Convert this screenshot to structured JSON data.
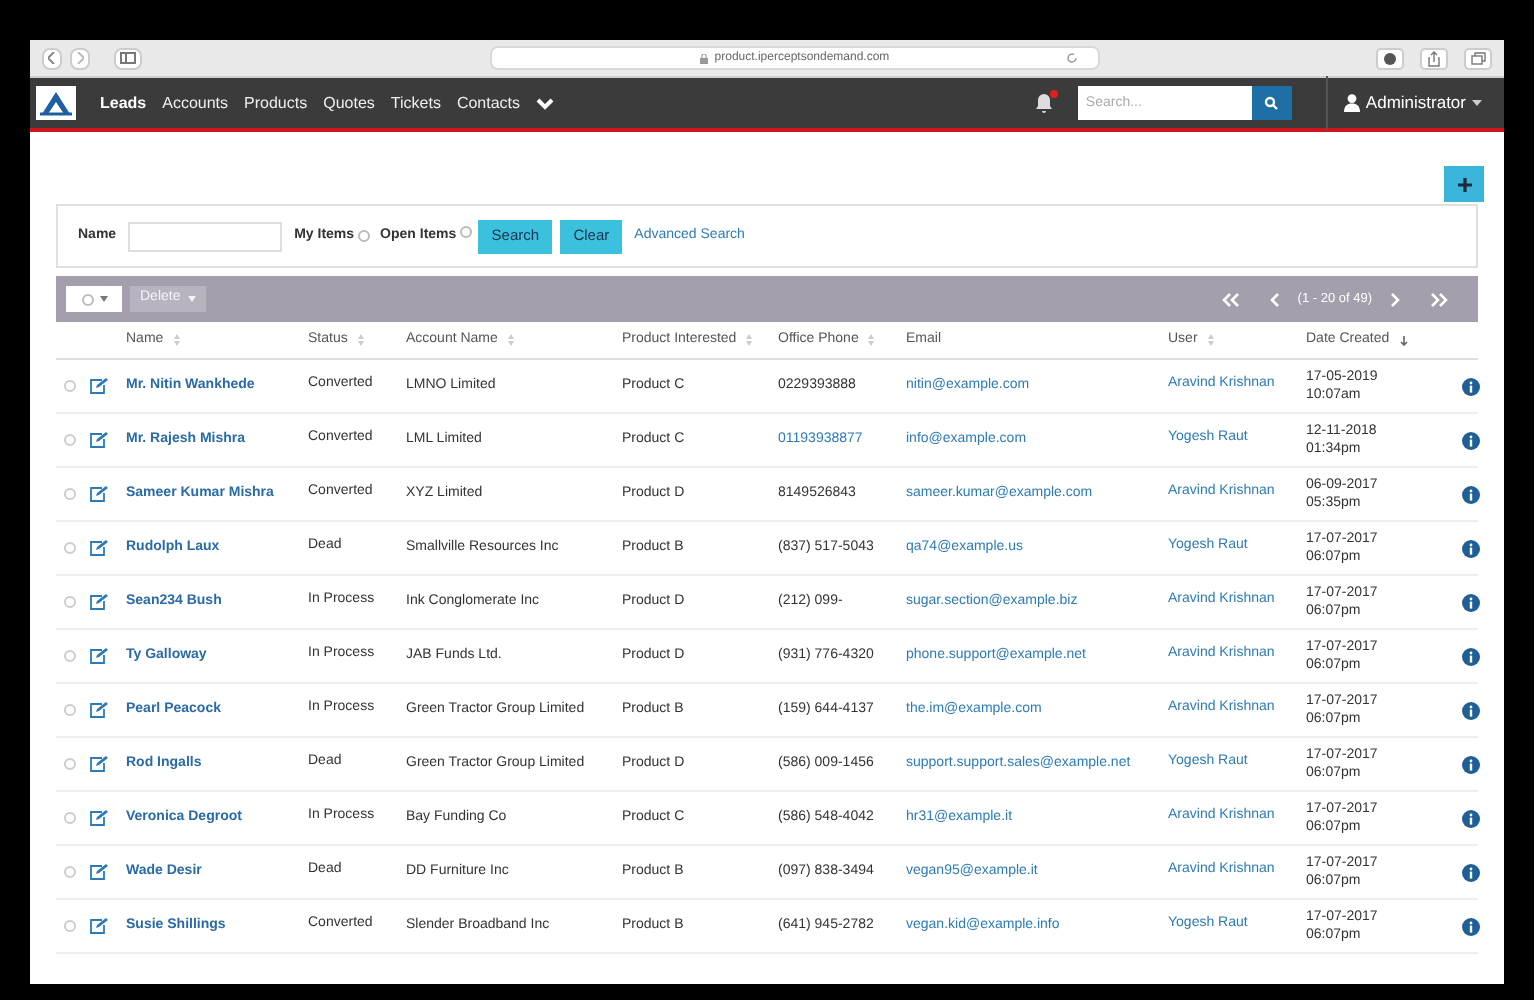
{
  "browser": {
    "url": "product.iperceptsondemand.com"
  },
  "nav": {
    "items": [
      {
        "label": "Leads",
        "selected": true
      },
      {
        "label": "Accounts",
        "selected": false
      },
      {
        "label": "Products",
        "selected": false
      },
      {
        "label": "Quotes",
        "selected": false
      },
      {
        "label": "Tickets",
        "selected": false
      },
      {
        "label": "Contacts",
        "selected": false
      }
    ],
    "notification": true,
    "search_placeholder": "Search...",
    "user": "Administrator"
  },
  "filter": {
    "name_label": "Name",
    "my_items": {
      "label": "My Items",
      "checked": false
    },
    "open_items": {
      "label": "Open Items",
      "checked": false
    },
    "search": "Search",
    "clear": "Clear",
    "advanced": "Advanced Search"
  },
  "toolbar": {
    "bulk_action": "Delete",
    "bulk_disabled": true,
    "page_info": "(1 - 20 of 49)"
  },
  "table": {
    "columns": [
      {
        "label": "Name",
        "sortable": true,
        "sorted": false
      },
      {
        "label": "Status",
        "sortable": true,
        "sorted": false
      },
      {
        "label": "Account Name",
        "sortable": true,
        "sorted": false
      },
      {
        "label": "Product Interested",
        "sortable": true,
        "sorted": false
      },
      {
        "label": "Office Phone",
        "sortable": true,
        "sorted": false
      },
      {
        "label": "Email",
        "sortable": false
      },
      {
        "label": "User",
        "sortable": true,
        "sorted": false
      },
      {
        "label": "Date Created",
        "sortable": true,
        "sorted": true
      }
    ],
    "rows": [
      {
        "checked": false,
        "name": "Mr. Nitin Wankhede",
        "status": "Converted",
        "account": "LMNO Limited",
        "product": "Product C",
        "phone": "0229393888",
        "phone_linked": false,
        "email": "nitin@example.com",
        "user": "Aravind Krishnan",
        "date": "17-05-2019",
        "time": "10:07am"
      },
      {
        "checked": false,
        "name": "Mr. Rajesh Mishra",
        "status": "Converted",
        "account": "LML Limited",
        "product": "Product C",
        "phone": "01193938877",
        "phone_linked": true,
        "email": "info@example.com",
        "user": "Yogesh Raut",
        "date": "12-11-2018",
        "time": "01:34pm"
      },
      {
        "checked": false,
        "name": "Sameer Kumar Mishra",
        "status": "Converted",
        "account": "XYZ Limited",
        "product": "Product D",
        "phone": "8149526843",
        "phone_linked": false,
        "email": "sameer.kumar@example.com",
        "user": "Aravind Krishnan",
        "date": "06-09-2017",
        "time": "05:35pm"
      },
      {
        "checked": false,
        "name": "Rudolph Laux",
        "status": "Dead",
        "account": "Smallville Resources Inc",
        "product": "Product B",
        "phone": "(837) 517-5043",
        "phone_linked": false,
        "email": "qa74@example.us",
        "user": "Yogesh Raut",
        "date": "17-07-2017",
        "time": "06:07pm"
      },
      {
        "checked": false,
        "name": "Sean234 Bush",
        "status": "In Process",
        "account": "Ink Conglomerate Inc",
        "product": "Product D",
        "phone": "(212) 099-",
        "phone_linked": false,
        "email": "sugar.section@example.biz",
        "user": "Aravind Krishnan",
        "date": "17-07-2017",
        "time": "06:07pm"
      },
      {
        "checked": false,
        "name": "Ty Galloway",
        "status": "In Process",
        "account": "JAB Funds Ltd.",
        "product": "Product D",
        "phone": "(931) 776-4320",
        "phone_linked": false,
        "email": "phone.support@example.net",
        "user": "Aravind Krishnan",
        "date": "17-07-2017",
        "time": "06:07pm"
      },
      {
        "checked": false,
        "name": "Pearl Peacock",
        "status": "In Process",
        "account": "Green Tractor Group Limited",
        "product": "Product B",
        "phone": "(159) 644-4137",
        "phone_linked": false,
        "email": "the.im@example.com",
        "user": "Aravind Krishnan",
        "date": "17-07-2017",
        "time": "06:07pm"
      },
      {
        "checked": false,
        "name": "Rod Ingalls",
        "status": "Dead",
        "account": "Green Tractor Group Limited",
        "product": "Product D",
        "phone": "(586) 009-1456",
        "phone_linked": false,
        "email": "support.support.sales@example.net",
        "user": "Yogesh Raut",
        "date": "17-07-2017",
        "time": "06:07pm"
      },
      {
        "checked": false,
        "name": "Veronica Degroot",
        "status": "In Process",
        "account": "Bay Funding Co",
        "product": "Product C",
        "phone": "(586) 548-4042",
        "phone_linked": false,
        "email": "hr31@example.it",
        "user": "Aravind Krishnan",
        "date": "17-07-2017",
        "time": "06:07pm"
      },
      {
        "checked": false,
        "name": "Wade Desir",
        "status": "Dead",
        "account": "DD Furniture Inc",
        "product": "Product B",
        "phone": "(097) 838-3494",
        "phone_linked": false,
        "email": "vegan95@example.it",
        "user": "Aravind Krishnan",
        "date": "17-07-2017",
        "time": "06:07pm"
      },
      {
        "checked": false,
        "name": "Susie Shillings",
        "status": "Converted",
        "account": "Slender Broadband Inc",
        "product": "Product B",
        "phone": "(641) 945-2782",
        "phone_linked": false,
        "email": "vegan.kid@example.info",
        "user": "Yogesh Raut",
        "date": "17-07-2017",
        "time": "06:07pm"
      }
    ]
  }
}
